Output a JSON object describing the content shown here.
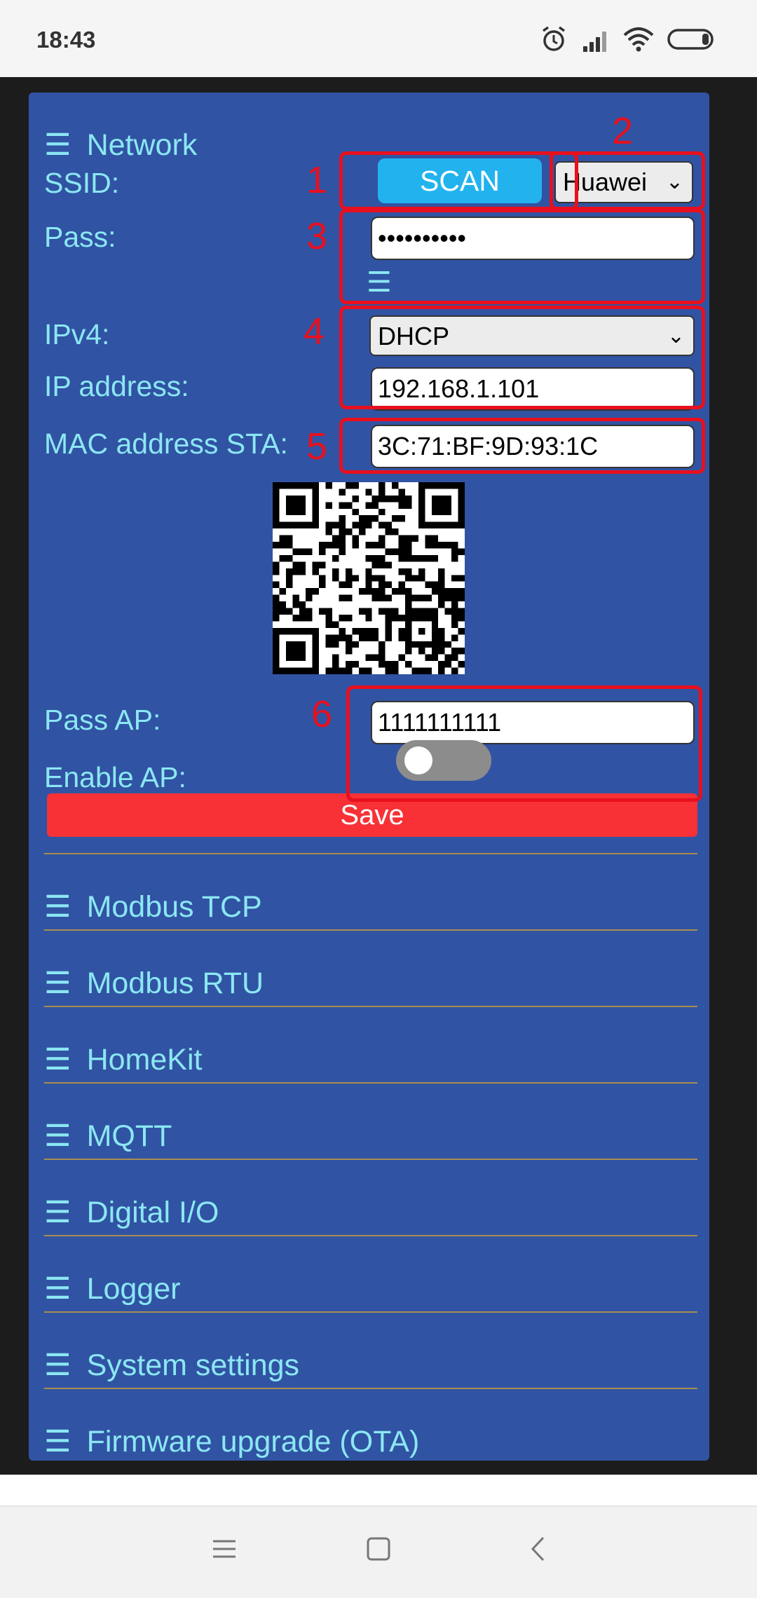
{
  "status_bar": {
    "time": "18:43",
    "icons": [
      "alarm-icon",
      "signal-icon",
      "wifi-icon",
      "battery-icon"
    ]
  },
  "network": {
    "title": "Network",
    "ssid_label": "SSID:",
    "scan_label": "SCAN",
    "ssid_selected": "Huawei",
    "pass_label": "Pass:",
    "pass_value": "••••••••••",
    "ipv4_label": "IPv4:",
    "ipv4_selected": "DHCP",
    "ip_label": "IP address:",
    "ip_value": "192.168.1.101",
    "mac_label": "MAC address STA:",
    "mac_value": "3C:71:BF:9D:93:1C",
    "pass_ap_label": "Pass AP:",
    "pass_ap_value": "1111111111",
    "enable_ap_label": "Enable AP:",
    "enable_ap_on": false,
    "save_label": "Save"
  },
  "annotations": [
    "1",
    "2",
    "3",
    "4",
    "5",
    "6"
  ],
  "sections": [
    {
      "label": "Modbus TCP"
    },
    {
      "label": "Modbus RTU"
    },
    {
      "label": "HomeKit"
    },
    {
      "label": "MQTT"
    },
    {
      "label": "Digital I/O"
    },
    {
      "label": "Logger"
    },
    {
      "label": "System settings"
    },
    {
      "label": "Firmware upgrade (OTA)"
    }
  ],
  "colors": {
    "panel": "#3153a3",
    "label_text": "#8be7f3",
    "scan_button": "#22b3ee",
    "save_button": "#f73136",
    "annotation_red": "#e8101e",
    "divider": "#a88e4f"
  }
}
